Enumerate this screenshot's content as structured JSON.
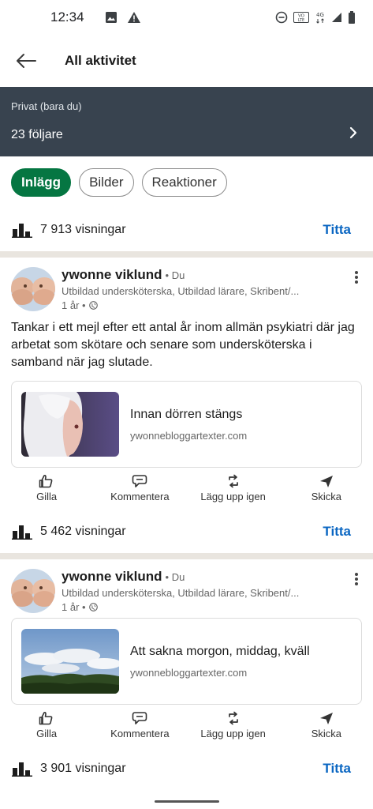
{
  "status_bar": {
    "time": "12:34",
    "network": "4G"
  },
  "header": {
    "title": "All aktivitet"
  },
  "banner": {
    "subtitle": "Privat (bara du)",
    "followers": "23 följare"
  },
  "filters": [
    {
      "label": "Inlägg",
      "active": true
    },
    {
      "label": "Bilder",
      "active": false
    },
    {
      "label": "Reaktioner",
      "active": false
    }
  ],
  "views_top": {
    "text": "7 913 visningar",
    "link": "Titta"
  },
  "posts": [
    {
      "author": "ywonne viklund",
      "degree": "• Du",
      "headline": "Utbildad undersköterska, Utbildad lärare, Skribent/...",
      "time": "1 år •",
      "text": "Tankar i ett mejl efter ett antal år inom allmän psykiatri där jag arbetat som skötare och senare som undersköterska i samband när jag slutade.",
      "link_title": "Innan dörren stängs",
      "link_domain": "ywonnebloggartexter.com",
      "actions": [
        "Gilla",
        "Kommentera",
        "Lägg upp igen",
        "Skicka"
      ],
      "views": "5 462 visningar",
      "views_link": "Titta"
    },
    {
      "author": "ywonne viklund",
      "degree": "• Du",
      "headline": "Utbildad undersköterska, Utbildad lärare, Skribent/...",
      "time": "1 år •",
      "link_title": "Att sakna morgon, middag, kväll",
      "link_domain": "ywonnebloggartexter.com",
      "actions": [
        "Gilla",
        "Kommentera",
        "Lägg upp igen",
        "Skicka"
      ],
      "views": "3 901 visningar",
      "views_link": "Titta"
    }
  ],
  "colors": {
    "accent_green": "#057642",
    "link_blue": "#0a66c2",
    "banner_bg": "#38434f"
  }
}
